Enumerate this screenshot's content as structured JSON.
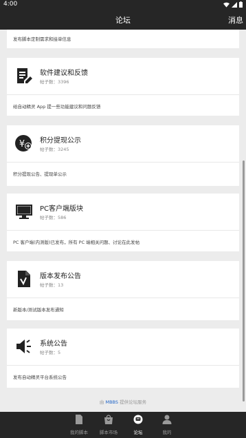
{
  "status_bar": {
    "time": "4:00"
  },
  "app_bar": {
    "title": "论坛",
    "action": "消息"
  },
  "partial_card": {
    "description": "发布脚本定制需求和接单信息"
  },
  "forums": [
    {
      "title": "软件建议和反馈",
      "count_label": "帖子数：3396",
      "description": "给自动精灵 App 提一些功能建议和问题反馈",
      "icon": "document-edit-icon"
    },
    {
      "title": "积分提现公示",
      "count_label": "帖子数：3245",
      "description": "积分提现公告、提现单公示",
      "icon": "coin-add-icon"
    },
    {
      "title": "PC客户端版块",
      "count_label": "帖子数：586",
      "description": "PC 客户端(内测版)已发布，所有 PC 端相关问题、讨论在此发帖",
      "icon": "monitor-icon"
    },
    {
      "title": "版本发布公告",
      "count_label": "帖子数：13",
      "description": "新版本/测试版本发布通知",
      "icon": "document-check-icon"
    },
    {
      "title": "系统公告",
      "count_label": "帖子数：5",
      "description": "发布自动精灵平台系统公告",
      "icon": "speaker-icon"
    }
  ],
  "footer": {
    "prefix": "由",
    "brand": "MBBS",
    "suffix": "提供论坛服务"
  },
  "bottom_nav": [
    {
      "label": "我的脚本",
      "icon": "file-icon",
      "active": false
    },
    {
      "label": "脚本市场",
      "icon": "shopping-bag-icon",
      "active": false
    },
    {
      "label": "论坛",
      "icon": "forum-chat-icon",
      "active": true
    },
    {
      "label": "我的",
      "icon": "person-icon",
      "active": false
    }
  ],
  "colors": {
    "bar": "#262626",
    "background": "#ececec",
    "card": "#ffffff",
    "link": "#1f64c7"
  }
}
